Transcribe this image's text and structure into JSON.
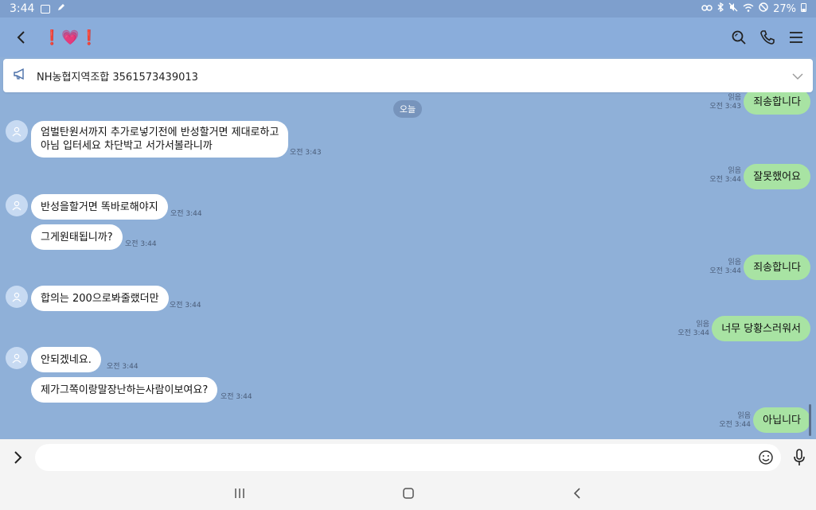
{
  "statusbar": {
    "time": "3:44",
    "battery": "27%"
  },
  "header": {
    "title": "❗💗❗"
  },
  "notice": {
    "text": "NH농협지역조합 3561573439013"
  },
  "chat": {
    "date_label": "오늘",
    "messages": [
      {
        "dir": "out",
        "text": "죄송합니다",
        "read": "읽음",
        "time": "오전 3:43"
      },
      {
        "dir": "in",
        "lines": [
          "엄벌탄원서까지 추가로넣기전에 반성할거면 제대로하고",
          "아님 입터세요 차단박고 서가서볼라니까"
        ],
        "time": "오전 3:43"
      },
      {
        "dir": "out",
        "text": "잘못했어요",
        "read": "읽음",
        "time": "오전 3:44"
      },
      {
        "dir": "in",
        "text": "반성을할거면 똑바로해야지",
        "time": "오전 3:44"
      },
      {
        "dir": "in",
        "text": "그게원태됩니까?",
        "time": "오전 3:44"
      },
      {
        "dir": "out",
        "text": "죄송합니다",
        "read": "읽음",
        "time": "오전 3:44"
      },
      {
        "dir": "in",
        "text": "합의는 200으로봐줄랬더만",
        "time": "오전 3:44"
      },
      {
        "dir": "out",
        "text": "너무 당황스러워서",
        "read": "읽음",
        "time": "오전 3:44"
      },
      {
        "dir": "in",
        "text": "안되겠네요.",
        "time": "오전 3:44"
      },
      {
        "dir": "in",
        "text": "제가그쪽이랑말장난하는사람이보여요?",
        "time": "오전 3:44"
      },
      {
        "dir": "out",
        "text": "아닙니다",
        "read": "읽음",
        "time": "오전 3:44"
      }
    ]
  },
  "composer": {
    "value": "",
    "placeholder": ""
  },
  "colors": {
    "chat_bg": "#8fb0d8",
    "out_bubble": "#a8e3a3",
    "in_bubble": "#ffffff",
    "title": "#e0242c"
  }
}
